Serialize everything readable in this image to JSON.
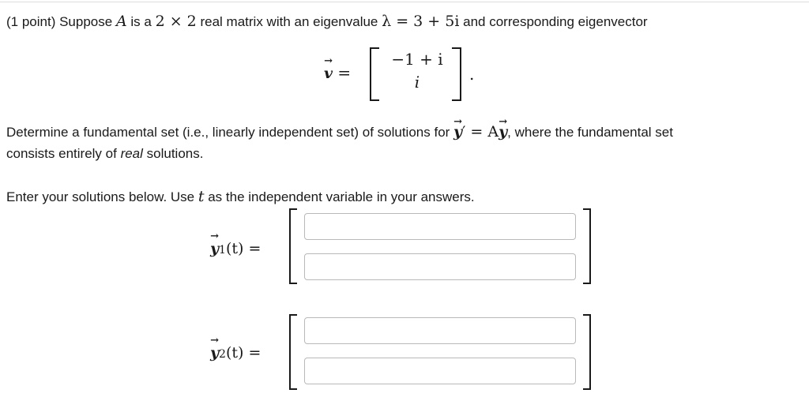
{
  "problem": {
    "line1": {
      "points": "(1 point)",
      "t1": " Suppose ",
      "A": "A",
      "t2": " is a ",
      "size": "2 × 2",
      "t3": " real matrix with an eigenvalue ",
      "lambda": "λ = 3 + 5i",
      "t4": " and corresponding eigenvector"
    },
    "eigvec": {
      "lhs": "v",
      "eq": " =",
      "top": "−1 + i",
      "bottom": "i",
      "dot": "."
    },
    "line2": {
      "t1": "Determine a fundamental set (i.e., linearly independent set) of solutions for ",
      "eq_y": "y",
      "eq_mid": "′ = A",
      "eq_y2": "y",
      "t2": ", where the fundamental set"
    },
    "line3": {
      "t1": "consists entirely of ",
      "em": "real",
      "t2": " solutions."
    },
    "line4": {
      "t1": "Enter your solutions below. Use ",
      "var": "t",
      "t2": " as the independent variable in your answers."
    }
  },
  "answers": {
    "y1": {
      "label_y": "y",
      "label_sub": "1",
      "label_rest": "(t) =",
      "top_value": "",
      "bottom_value": ""
    },
    "y2": {
      "label_y": "y",
      "label_sub": "2",
      "label_rest": "(t) =",
      "top_value": "",
      "bottom_value": ""
    }
  }
}
